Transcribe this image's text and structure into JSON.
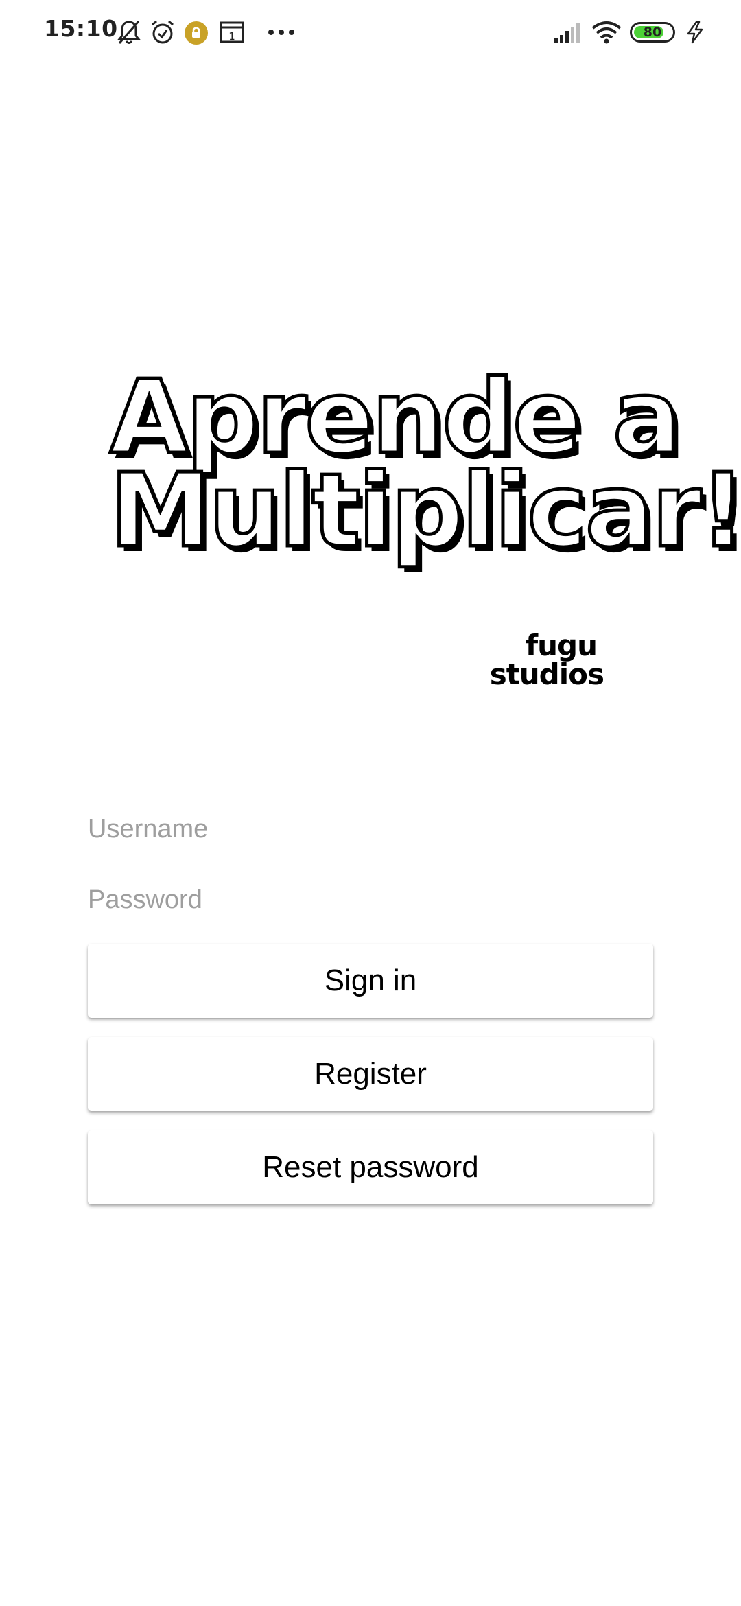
{
  "status_bar": {
    "time": "15:10",
    "battery_level": "80",
    "icons": [
      "mute-bell-icon",
      "alarm-clock-icon",
      "vpn-badge-icon",
      "calendar-icon",
      "more-icon",
      "signal-bars-icon",
      "wifi-icon",
      "battery-icon",
      "charging-bolt-icon"
    ],
    "calendar_day": "1",
    "battery_fill_color": "#4cd137"
  },
  "logo": {
    "line1": "Aprende a",
    "line2": "Multiplicar!"
  },
  "studio_logo": {
    "line1": "fugu",
    "line2": "studios"
  },
  "form": {
    "username_placeholder": "Username",
    "username_value": "",
    "password_placeholder": "Password",
    "password_value": ""
  },
  "buttons": {
    "sign_in": "Sign in",
    "register": "Register",
    "reset_password": "Reset password"
  },
  "colors": {
    "background": "#ffffff",
    "placeholder": "#9e9e9e",
    "text": "#000000"
  }
}
